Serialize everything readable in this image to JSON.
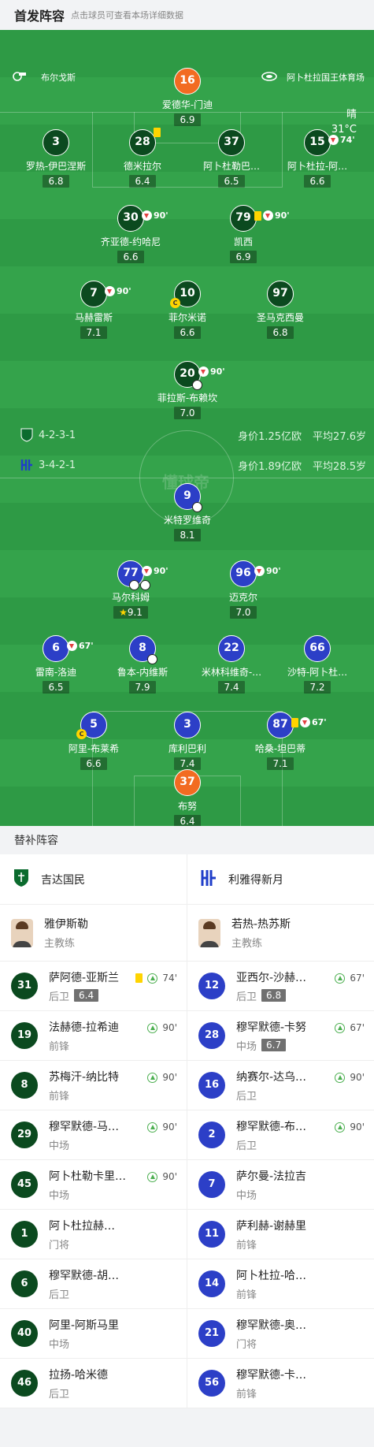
{
  "header": {
    "title": "首发阵容",
    "subtitle": "点击球员可查看本场详细数据"
  },
  "pitch": {
    "home_team_label": "布尔戈斯",
    "venue": "阿卜杜拉国王体育场",
    "weather": "晴",
    "temperature": "31°C",
    "watermark": "懂球帝",
    "home_formation": "4-2-3-1",
    "away_formation": "3-4-2-1",
    "home_value": "身价1.25亿欧",
    "home_age": "平均27.6岁",
    "away_value": "身价1.89亿欧",
    "away_age": "平均28.5岁"
  },
  "home_players": [
    {
      "num": "16",
      "name": "爱德华-门迪",
      "rating": "6.9"
    },
    {
      "num": "3",
      "name": "罗热-伊巴涅斯",
      "rating": "6.8"
    },
    {
      "num": "28",
      "name": "德米拉尔",
      "rating": "6.4"
    },
    {
      "num": "37",
      "name": "阿卜杜勒巴…",
      "rating": "6.5"
    },
    {
      "num": "15",
      "name": "阿卜杜拉-阿…",
      "rating": "6.6",
      "sub": "74'"
    },
    {
      "num": "30",
      "name": "齐亚德-约哈尼",
      "rating": "6.6",
      "sub": "90'"
    },
    {
      "num": "79",
      "name": "凯西",
      "rating": "6.9",
      "sub": "90'"
    },
    {
      "num": "7",
      "name": "马赫雷斯",
      "rating": "7.1",
      "sub": "90'"
    },
    {
      "num": "10",
      "name": "菲尔米诺",
      "rating": "6.6"
    },
    {
      "num": "97",
      "name": "圣马克西曼",
      "rating": "6.8"
    },
    {
      "num": "20",
      "name": "菲拉斯-布赖坎",
      "rating": "7.0",
      "sub": "90'"
    }
  ],
  "away_players": [
    {
      "num": "9",
      "name": "米特罗维奇",
      "rating": "8.1"
    },
    {
      "num": "77",
      "name": "马尔科姆",
      "rating": "9.1",
      "sub": "90'"
    },
    {
      "num": "96",
      "name": "迈克尔",
      "rating": "7.0",
      "sub": "90'"
    },
    {
      "num": "6",
      "name": "雷南-洛迪",
      "rating": "6.5",
      "sub": "67'"
    },
    {
      "num": "8",
      "name": "鲁本-内维斯",
      "rating": "7.9"
    },
    {
      "num": "22",
      "name": "米林科维奇-…",
      "rating": "7.4"
    },
    {
      "num": "66",
      "name": "沙特-阿卜杜…",
      "rating": "7.2"
    },
    {
      "num": "5",
      "name": "阿里-布莱希",
      "rating": "6.6"
    },
    {
      "num": "3",
      "name": "库利巴利",
      "rating": "7.4"
    },
    {
      "num": "87",
      "name": "哈桑-坦巴蒂",
      "rating": "7.1",
      "sub": "67'"
    },
    {
      "num": "37",
      "name": "布努",
      "rating": "6.4"
    }
  ],
  "subs": {
    "title": "替补阵容",
    "home_team": "吉达国民",
    "away_team": "利雅得新月",
    "home_coach": "雅伊斯勒",
    "away_coach": "若热-热苏斯",
    "coach_role": "主教练",
    "home": [
      {
        "num": "31",
        "name": "萨阿德-亚斯兰",
        "pos": "后卫",
        "rating": "6.4",
        "time": "74'",
        "yc": true
      },
      {
        "num": "19",
        "name": "法赫德-拉希迪",
        "pos": "前锋",
        "time": "90'"
      },
      {
        "num": "8",
        "name": "苏梅汗-纳比特",
        "pos": "前锋",
        "time": "90'"
      },
      {
        "num": "29",
        "name": "穆罕默德-马…",
        "pos": "中场",
        "time": "90'"
      },
      {
        "num": "45",
        "name": "阿卜杜勒卡里…",
        "pos": "中场",
        "time": "90'"
      },
      {
        "num": "1",
        "name": "阿卜杜拉赫…",
        "pos": "门将"
      },
      {
        "num": "6",
        "name": "穆罕默德-胡…",
        "pos": "后卫"
      },
      {
        "num": "40",
        "name": "阿里-阿斯马里",
        "pos": "中场"
      },
      {
        "num": "46",
        "name": "拉扬-哈米德",
        "pos": "后卫"
      }
    ],
    "away": [
      {
        "num": "12",
        "name": "亚西尔-沙赫…",
        "pos": "后卫",
        "rating": "6.8",
        "time": "67'"
      },
      {
        "num": "28",
        "name": "穆罕默德-卡努",
        "pos": "中场",
        "rating": "6.7",
        "time": "67'"
      },
      {
        "num": "16",
        "name": "纳赛尔-达乌…",
        "pos": "后卫",
        "time": "90'"
      },
      {
        "num": "2",
        "name": "穆罕默德-布…",
        "pos": "后卫",
        "time": "90'"
      },
      {
        "num": "7",
        "name": "萨尔曼-法拉吉",
        "pos": "中场"
      },
      {
        "num": "11",
        "name": "萨利赫-谢赫里",
        "pos": "前锋"
      },
      {
        "num": "14",
        "name": "阿卜杜拉-哈…",
        "pos": "前锋"
      },
      {
        "num": "21",
        "name": "穆罕默德-奥…",
        "pos": "门将"
      },
      {
        "num": "56",
        "name": "穆罕默德-卡…",
        "pos": "前锋"
      }
    ]
  }
}
